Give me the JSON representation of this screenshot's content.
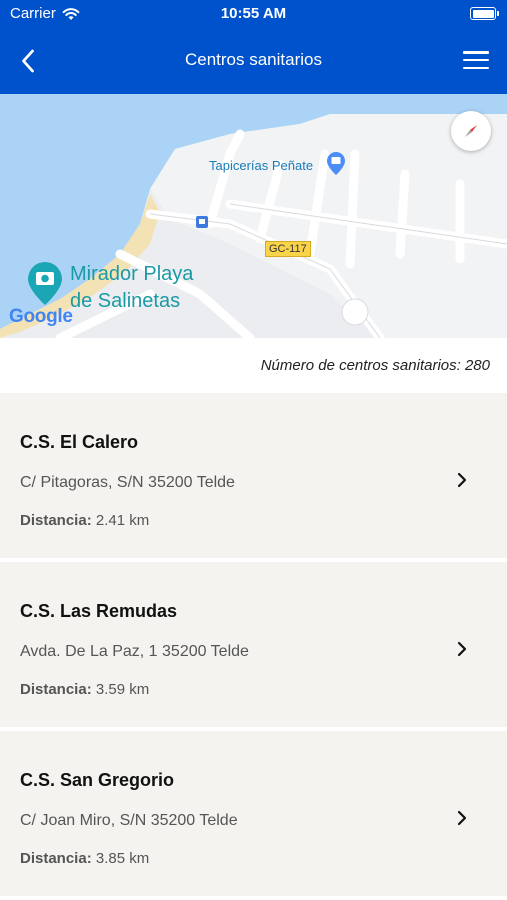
{
  "status_bar": {
    "carrier": "Carrier",
    "time": "10:55 AM"
  },
  "nav": {
    "title": "Centros sanitarios"
  },
  "map": {
    "labels": {
      "poi_1": "Tapicerías Peñate",
      "poi_2_line1": "Mirador Playa",
      "poi_2_line2": "de Salinetas",
      "road": "GC-117",
      "attribution": "Google"
    }
  },
  "summary": {
    "count_text": "Número de centros sanitarios: 280"
  },
  "centers": [
    {
      "name": "C.S. El Calero",
      "address": "C/ Pitagoras, S/N 35200 Telde",
      "distance_label": "Distancia:",
      "distance": "2.41 km"
    },
    {
      "name": "C.S. Las Remudas",
      "address": "Avda. De La Paz, 1 35200 Telde",
      "distance_label": "Distancia:",
      "distance": "3.59 km"
    },
    {
      "name": "C.S. San Gregorio",
      "address": "C/ Joan Miro, S/N 35200 Telde",
      "distance_label": "Distancia:",
      "distance": "3.85 km"
    }
  ],
  "colors": {
    "brand_blue": "#0052cc",
    "card_bg": "#f4f3f0",
    "water": "#abd3f5"
  }
}
